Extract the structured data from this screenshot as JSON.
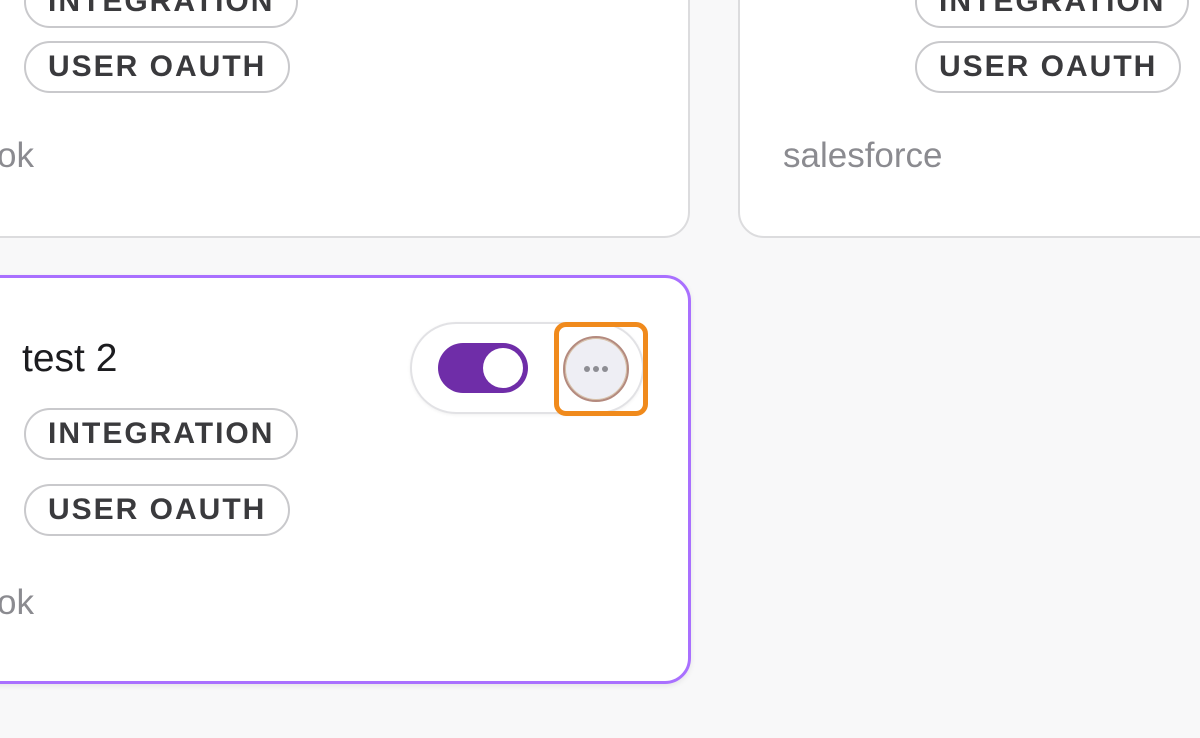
{
  "cards": [
    {
      "id": "card-tl",
      "badges": [
        "INTEGRATION",
        "USER OAUTH"
      ],
      "meta": "ok"
    },
    {
      "id": "card-tr",
      "badges": [
        "INTEGRATION",
        "USER OAUTH"
      ],
      "meta": "salesforce"
    },
    {
      "id": "card-main",
      "title": "test 2",
      "badges": [
        "INTEGRATION",
        "USER OAUTH"
      ],
      "meta": "ok",
      "toggle_on": true,
      "selected": true
    }
  ],
  "colors": {
    "selected_border": "#a970ff",
    "toggle_on": "#6f2da8",
    "highlight": "#f08a1c"
  },
  "icons": {
    "more": "more-horizontal-icon"
  }
}
